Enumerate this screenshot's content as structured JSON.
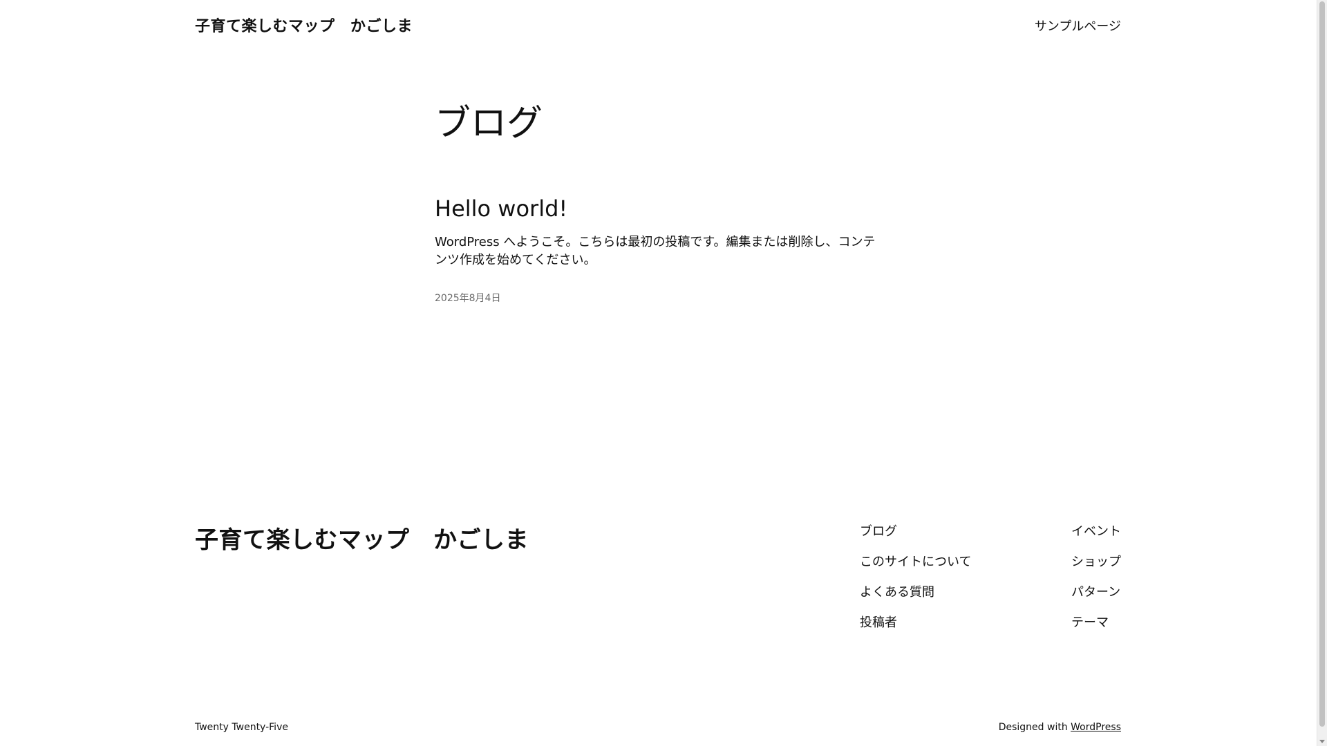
{
  "header": {
    "site_title": "子育て楽しむマップ　かごしま",
    "nav": [
      {
        "label": "サンプルページ"
      }
    ]
  },
  "main": {
    "heading": "ブログ",
    "posts": [
      {
        "title": "Hello world!",
        "excerpt": "WordPress へようこそ。こちらは最初の投稿です。編集または削除し、コンテンツ作成を始めてください。",
        "date": "2025年8月4日"
      }
    ]
  },
  "footer": {
    "site_title": "子育て楽しむマップ　かごしま",
    "nav_col1": [
      {
        "label": "ブログ"
      },
      {
        "label": "このサイトについて"
      },
      {
        "label": "よくある質問"
      },
      {
        "label": "投稿者"
      }
    ],
    "nav_col2": [
      {
        "label": "イベント"
      },
      {
        "label": "ショップ"
      },
      {
        "label": "パターン"
      },
      {
        "label": "テーマ"
      }
    ],
    "theme_name": "Twenty Twenty-Five",
    "credit_prefix": "Designed with ",
    "credit_link": "WordPress"
  }
}
